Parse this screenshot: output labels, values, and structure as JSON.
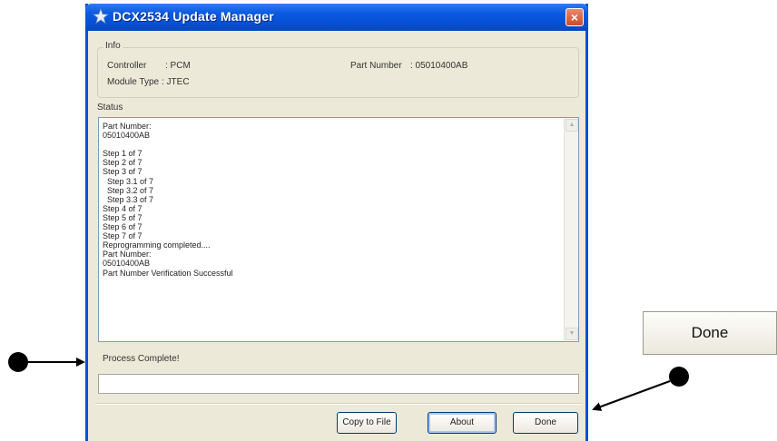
{
  "window": {
    "title": "DCX2534 Update Manager",
    "close_glyph": "×"
  },
  "info": {
    "group_label": "Info",
    "controller_label": "Controller",
    "controller_value": ": PCM",
    "module_label": "Module Type",
    "module_value": ": JTEC",
    "part_label": "Part Number",
    "part_value": ": 05010400AB"
  },
  "status": {
    "label": "Status",
    "lines": [
      "Part Number:",
      "05010400AB",
      "",
      "Step 1 of 7",
      "Step 2 of 7",
      "Step 3 of 7",
      "  Step 3.1 of 7",
      "  Step 3.2 of 7",
      "  Step 3.3 of 7",
      "Step 4 of 7",
      "Step 5 of 7",
      "Step 6 of 7",
      "Step 7 of 7",
      "Reprogramming completed....",
      "Part Number:",
      "05010400AB",
      "Part Number Verification Successful"
    ]
  },
  "progress": {
    "label": "Process Complete!"
  },
  "buttons": {
    "copy_to_file": "Copy to File",
    "about": "About",
    "done": "Done"
  },
  "zoomed_button": {
    "label": "Done"
  },
  "icons": {
    "app": "star-icon",
    "close": "close-icon",
    "scroll_up": "scroll-up-arrow-icon",
    "scroll_down": "scroll-down-arrow-icon"
  }
}
